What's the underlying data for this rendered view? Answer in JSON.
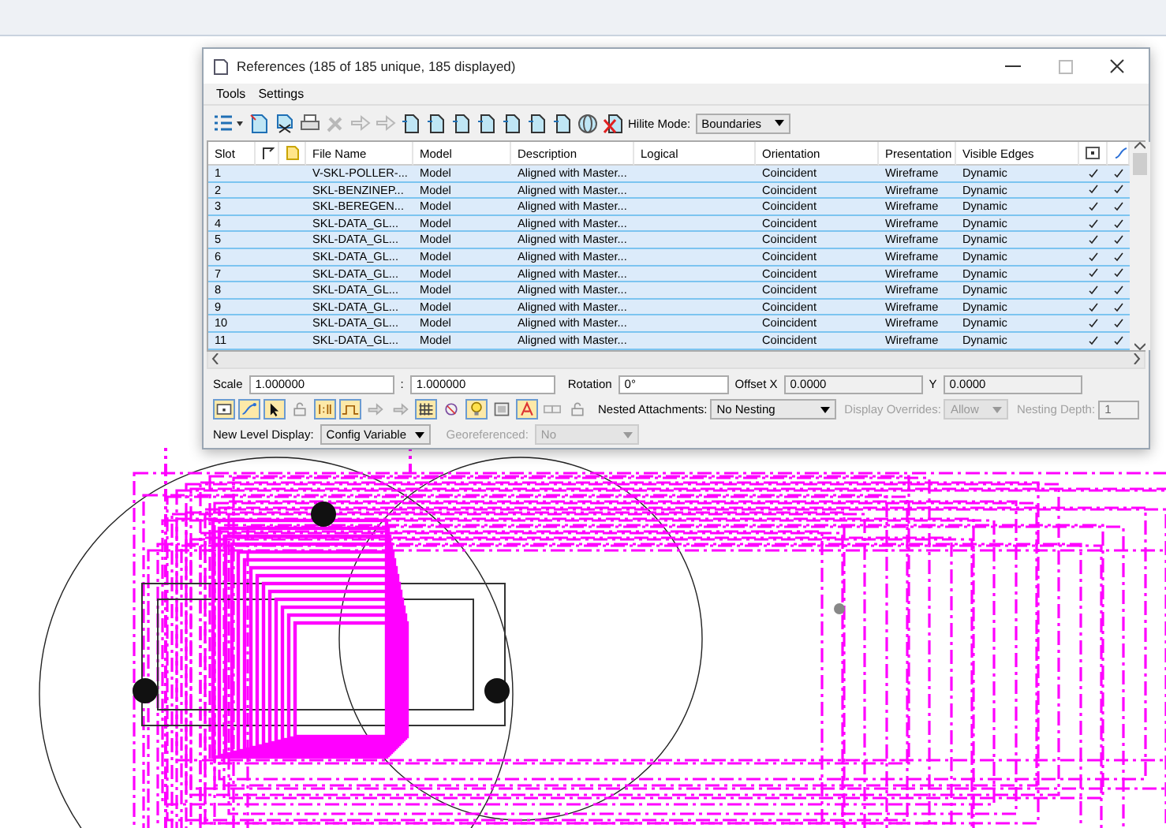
{
  "window": {
    "title": "References (185 of 185 unique, 185 displayed)"
  },
  "menu": [
    {
      "label": "Tools"
    },
    {
      "label": "Settings"
    }
  ],
  "toolbar": [
    {
      "kind": "list",
      "disabled": false
    },
    {
      "kind": "attach",
      "disabled": false
    },
    {
      "kind": "detach",
      "disabled": false
    },
    {
      "kind": "print",
      "disabled": false
    },
    {
      "kind": "tool",
      "disabled": true
    },
    {
      "kind": "arrow",
      "disabled": true
    },
    {
      "kind": "arrow",
      "disabled": true
    },
    {
      "kind": "doc",
      "disabled": false
    },
    {
      "kind": "doc",
      "disabled": false
    },
    {
      "kind": "doc",
      "disabled": false
    },
    {
      "kind": "doc",
      "disabled": false
    },
    {
      "kind": "doc",
      "disabled": false
    },
    {
      "kind": "doc",
      "disabled": false
    },
    {
      "kind": "doc",
      "disabled": false
    },
    {
      "kind": "globe",
      "disabled": false
    },
    {
      "kind": "delete",
      "disabled": false
    }
  ],
  "hilite_mode": {
    "label": "Hilite Mode:",
    "value": "Boundaries"
  },
  "table": {
    "columns": [
      "Slot",
      "File Name",
      "Model",
      "Description",
      "Logical",
      "Orientation",
      "Presentation",
      "Visible Edges"
    ],
    "rows": [
      {
        "slot": "1",
        "file": "V-SKL-POLLER-...",
        "model": "Model",
        "description": "Aligned with Master...",
        "orientation": "Coincident",
        "presentation": "Wireframe",
        "edges": "Dynamic",
        "display": true,
        "snap": true,
        "selected": true
      },
      {
        "slot": "2",
        "file": "SKL-BENZINEP...",
        "model": "Model",
        "description": "Aligned with Master...",
        "orientation": "Coincident",
        "presentation": "Wireframe",
        "edges": "Dynamic",
        "display": true,
        "snap": true,
        "selected": true
      },
      {
        "slot": "3",
        "file": "SKL-BEREGEN...",
        "model": "Model",
        "description": "Aligned with Master...",
        "orientation": "Coincident",
        "presentation": "Wireframe",
        "edges": "Dynamic",
        "display": true,
        "snap": true,
        "selected": true
      },
      {
        "slot": "4",
        "file": "SKL-DATA_GL...",
        "model": "Model",
        "description": "Aligned with Master...",
        "orientation": "Coincident",
        "presentation": "Wireframe",
        "edges": "Dynamic",
        "display": true,
        "snap": true,
        "selected": true
      },
      {
        "slot": "5",
        "file": "SKL-DATA_GL...",
        "model": "Model",
        "description": "Aligned with Master...",
        "orientation": "Coincident",
        "presentation": "Wireframe",
        "edges": "Dynamic",
        "display": true,
        "snap": true,
        "selected": true
      },
      {
        "slot": "6",
        "file": "SKL-DATA_GL...",
        "model": "Model",
        "description": "Aligned with Master...",
        "orientation": "Coincident",
        "presentation": "Wireframe",
        "edges": "Dynamic",
        "display": true,
        "snap": true,
        "selected": true
      },
      {
        "slot": "7",
        "file": "SKL-DATA_GL...",
        "model": "Model",
        "description": "Aligned with Master...",
        "orientation": "Coincident",
        "presentation": "Wireframe",
        "edges": "Dynamic",
        "display": true,
        "snap": true,
        "selected": true
      },
      {
        "slot": "8",
        "file": "SKL-DATA_GL...",
        "model": "Model",
        "description": "Aligned with Master...",
        "orientation": "Coincident",
        "presentation": "Wireframe",
        "edges": "Dynamic",
        "display": true,
        "snap": true,
        "selected": true
      },
      {
        "slot": "9",
        "file": "SKL-DATA_GL...",
        "model": "Model",
        "description": "Aligned with Master...",
        "orientation": "Coincident",
        "presentation": "Wireframe",
        "edges": "Dynamic",
        "display": true,
        "snap": true,
        "selected": true
      },
      {
        "slot": "10",
        "file": "SKL-DATA_GL...",
        "model": "Model",
        "description": "Aligned with Master...",
        "orientation": "Coincident",
        "presentation": "Wireframe",
        "edges": "Dynamic",
        "display": true,
        "snap": true,
        "selected": true
      },
      {
        "slot": "11",
        "file": "SKL-DATA_GL...",
        "model": "Model",
        "description": "Aligned with Master...",
        "orientation": "Coincident",
        "presentation": "Wireframe",
        "edges": "Dynamic",
        "display": true,
        "snap": true,
        "selected": true
      }
    ]
  },
  "scale": {
    "label": "Scale",
    "value1": "1.000000",
    "separator": ":",
    "value2": "1.000000"
  },
  "rotation": {
    "label": "Rotation",
    "value": "0°"
  },
  "offset_x": {
    "label": "Offset X",
    "value": "0.0000"
  },
  "offset_y": {
    "label": "Y",
    "value": "0.0000"
  },
  "toggles": [
    {
      "kind": "display",
      "on": true
    },
    {
      "kind": "snap",
      "on": true
    },
    {
      "kind": "locate",
      "on": true
    },
    {
      "kind": "lock",
      "on": false
    },
    {
      "kind": "scale",
      "on": true
    },
    {
      "kind": "curve",
      "on": true
    },
    {
      "kind": "arrow",
      "on": false
    },
    {
      "kind": "arrow",
      "on": false
    },
    {
      "kind": "grid",
      "on": true
    },
    {
      "kind": "clip",
      "on": false
    },
    {
      "kind": "bulb",
      "on": true
    },
    {
      "kind": "image",
      "on": false
    },
    {
      "kind": "text",
      "on": true
    },
    {
      "kind": "link",
      "on": false
    },
    {
      "kind": "lock",
      "on": false
    }
  ],
  "nested_attachments": {
    "label": "Nested Attachments:",
    "value": "No Nesting"
  },
  "display_overrides": {
    "label": "Display Overrides:",
    "value": "Allow",
    "disabled": true
  },
  "nesting_depth": {
    "label": "Nesting Depth:",
    "value": "1",
    "disabled": true
  },
  "new_level_display": {
    "label": "New Level Display:",
    "value": "Config Variable"
  },
  "georeferenced": {
    "label": "Georeferenced:",
    "value": "No",
    "disabled": true
  }
}
